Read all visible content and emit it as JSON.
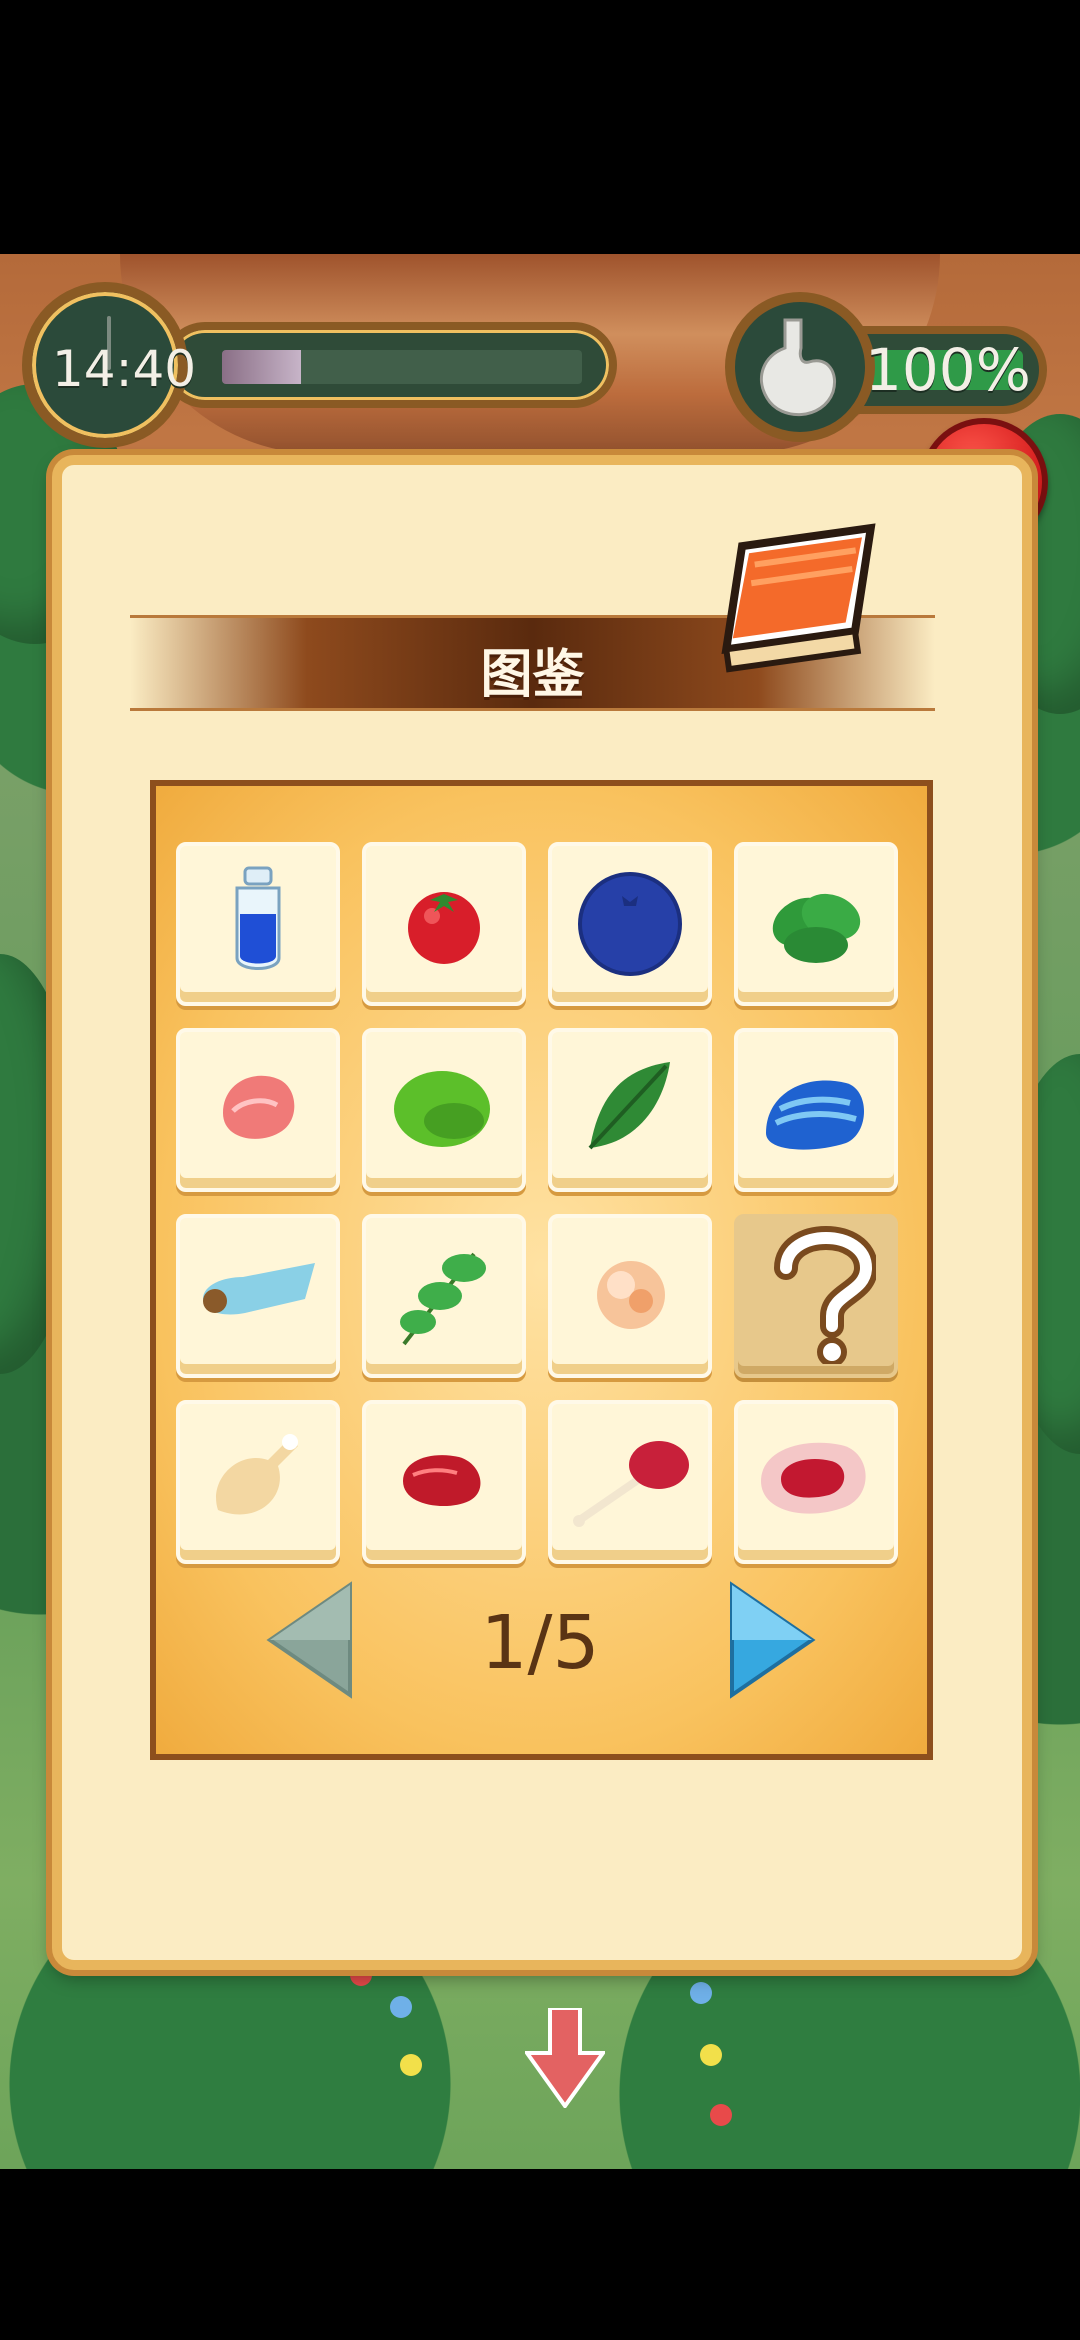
{
  "hud": {
    "time": "14:40",
    "time_progress": 0.22,
    "stomach": "100%",
    "stomach_level": 1.0
  },
  "panel": {
    "title": "图鉴",
    "page": "1/5"
  },
  "items": [
    {
      "name": "blue-potion-icon"
    },
    {
      "name": "tomato-icon"
    },
    {
      "name": "blueberry-icon"
    },
    {
      "name": "spinach-icon"
    },
    {
      "name": "raw-meat-icon"
    },
    {
      "name": "green-mango-icon"
    },
    {
      "name": "green-leaf-icon"
    },
    {
      "name": "blue-shell-icon"
    },
    {
      "name": "horn-shell-icon"
    },
    {
      "name": "herb-sprig-icon"
    },
    {
      "name": "shrimp-meat-icon"
    },
    {
      "name": "unknown-question-icon",
      "locked": true,
      "label": "?"
    },
    {
      "name": "chicken-drumstick-icon"
    },
    {
      "name": "red-meat-chunk-icon"
    },
    {
      "name": "meat-on-bone-icon"
    },
    {
      "name": "steak-icon"
    }
  ],
  "colors": {
    "panel": "#fbecc3",
    "grid": "#f9c25e",
    "close": "#d81f1f",
    "arrow_active": "#36a8e0",
    "arrow_inactive": "#8aa59a"
  }
}
